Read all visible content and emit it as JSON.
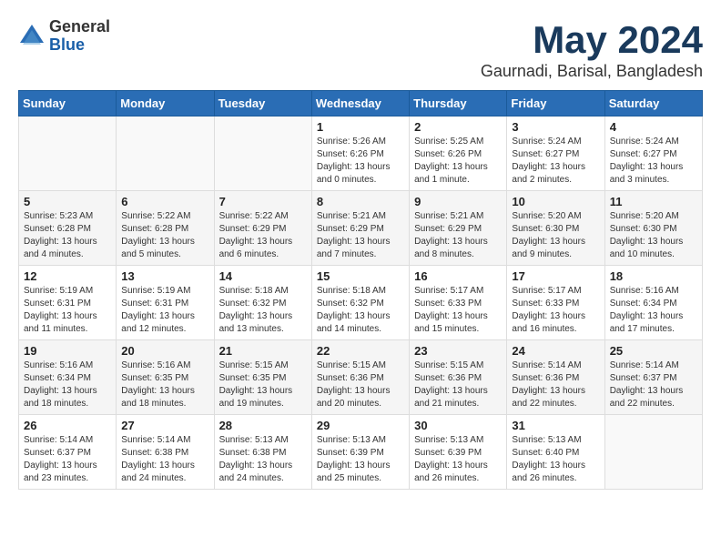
{
  "logo": {
    "general": "General",
    "blue": "Blue"
  },
  "title": "May 2024",
  "location": "Gaurnadi, Barisal, Bangladesh",
  "headers": [
    "Sunday",
    "Monday",
    "Tuesday",
    "Wednesday",
    "Thursday",
    "Friday",
    "Saturday"
  ],
  "weeks": [
    [
      {
        "day": "",
        "info": ""
      },
      {
        "day": "",
        "info": ""
      },
      {
        "day": "",
        "info": ""
      },
      {
        "day": "1",
        "info": "Sunrise: 5:26 AM\nSunset: 6:26 PM\nDaylight: 13 hours\nand 0 minutes."
      },
      {
        "day": "2",
        "info": "Sunrise: 5:25 AM\nSunset: 6:26 PM\nDaylight: 13 hours\nand 1 minute."
      },
      {
        "day": "3",
        "info": "Sunrise: 5:24 AM\nSunset: 6:27 PM\nDaylight: 13 hours\nand 2 minutes."
      },
      {
        "day": "4",
        "info": "Sunrise: 5:24 AM\nSunset: 6:27 PM\nDaylight: 13 hours\nand 3 minutes."
      }
    ],
    [
      {
        "day": "5",
        "info": "Sunrise: 5:23 AM\nSunset: 6:28 PM\nDaylight: 13 hours\nand 4 minutes."
      },
      {
        "day": "6",
        "info": "Sunrise: 5:22 AM\nSunset: 6:28 PM\nDaylight: 13 hours\nand 5 minutes."
      },
      {
        "day": "7",
        "info": "Sunrise: 5:22 AM\nSunset: 6:29 PM\nDaylight: 13 hours\nand 6 minutes."
      },
      {
        "day": "8",
        "info": "Sunrise: 5:21 AM\nSunset: 6:29 PM\nDaylight: 13 hours\nand 7 minutes."
      },
      {
        "day": "9",
        "info": "Sunrise: 5:21 AM\nSunset: 6:29 PM\nDaylight: 13 hours\nand 8 minutes."
      },
      {
        "day": "10",
        "info": "Sunrise: 5:20 AM\nSunset: 6:30 PM\nDaylight: 13 hours\nand 9 minutes."
      },
      {
        "day": "11",
        "info": "Sunrise: 5:20 AM\nSunset: 6:30 PM\nDaylight: 13 hours\nand 10 minutes."
      }
    ],
    [
      {
        "day": "12",
        "info": "Sunrise: 5:19 AM\nSunset: 6:31 PM\nDaylight: 13 hours\nand 11 minutes."
      },
      {
        "day": "13",
        "info": "Sunrise: 5:19 AM\nSunset: 6:31 PM\nDaylight: 13 hours\nand 12 minutes."
      },
      {
        "day": "14",
        "info": "Sunrise: 5:18 AM\nSunset: 6:32 PM\nDaylight: 13 hours\nand 13 minutes."
      },
      {
        "day": "15",
        "info": "Sunrise: 5:18 AM\nSunset: 6:32 PM\nDaylight: 13 hours\nand 14 minutes."
      },
      {
        "day": "16",
        "info": "Sunrise: 5:17 AM\nSunset: 6:33 PM\nDaylight: 13 hours\nand 15 minutes."
      },
      {
        "day": "17",
        "info": "Sunrise: 5:17 AM\nSunset: 6:33 PM\nDaylight: 13 hours\nand 16 minutes."
      },
      {
        "day": "18",
        "info": "Sunrise: 5:16 AM\nSunset: 6:34 PM\nDaylight: 13 hours\nand 17 minutes."
      }
    ],
    [
      {
        "day": "19",
        "info": "Sunrise: 5:16 AM\nSunset: 6:34 PM\nDaylight: 13 hours\nand 18 minutes."
      },
      {
        "day": "20",
        "info": "Sunrise: 5:16 AM\nSunset: 6:35 PM\nDaylight: 13 hours\nand 18 minutes."
      },
      {
        "day": "21",
        "info": "Sunrise: 5:15 AM\nSunset: 6:35 PM\nDaylight: 13 hours\nand 19 minutes."
      },
      {
        "day": "22",
        "info": "Sunrise: 5:15 AM\nSunset: 6:36 PM\nDaylight: 13 hours\nand 20 minutes."
      },
      {
        "day": "23",
        "info": "Sunrise: 5:15 AM\nSunset: 6:36 PM\nDaylight: 13 hours\nand 21 minutes."
      },
      {
        "day": "24",
        "info": "Sunrise: 5:14 AM\nSunset: 6:36 PM\nDaylight: 13 hours\nand 22 minutes."
      },
      {
        "day": "25",
        "info": "Sunrise: 5:14 AM\nSunset: 6:37 PM\nDaylight: 13 hours\nand 22 minutes."
      }
    ],
    [
      {
        "day": "26",
        "info": "Sunrise: 5:14 AM\nSunset: 6:37 PM\nDaylight: 13 hours\nand 23 minutes."
      },
      {
        "day": "27",
        "info": "Sunrise: 5:14 AM\nSunset: 6:38 PM\nDaylight: 13 hours\nand 24 minutes."
      },
      {
        "day": "28",
        "info": "Sunrise: 5:13 AM\nSunset: 6:38 PM\nDaylight: 13 hours\nand 24 minutes."
      },
      {
        "day": "29",
        "info": "Sunrise: 5:13 AM\nSunset: 6:39 PM\nDaylight: 13 hours\nand 25 minutes."
      },
      {
        "day": "30",
        "info": "Sunrise: 5:13 AM\nSunset: 6:39 PM\nDaylight: 13 hours\nand 26 minutes."
      },
      {
        "day": "31",
        "info": "Sunrise: 5:13 AM\nSunset: 6:40 PM\nDaylight: 13 hours\nand 26 minutes."
      },
      {
        "day": "",
        "info": ""
      }
    ]
  ]
}
